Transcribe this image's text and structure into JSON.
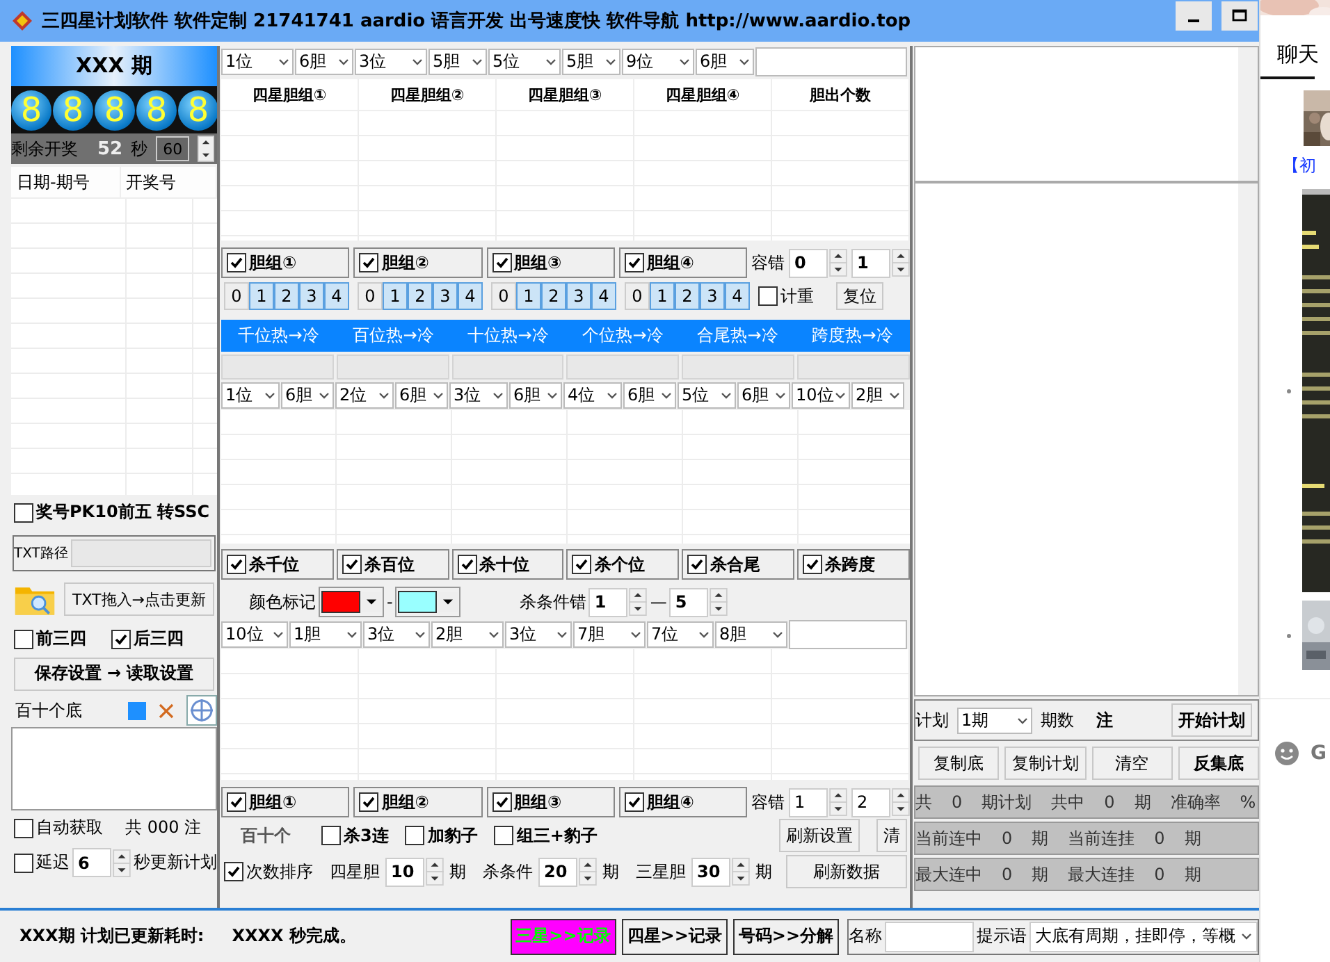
{
  "title": "三四星计划软件  软件定制 21741741 aardio 语言开发 出号速度快 软件导航 http://www.aardio.top",
  "left": {
    "period": "XXX 期",
    "balls": [
      "8",
      "8",
      "8",
      "8",
      "8"
    ],
    "countdown": {
      "label": "剩余开奖",
      "seconds": "52",
      "unit": "秒",
      "interval": "60"
    },
    "history_columns": [
      "日期-期号",
      "开奖号"
    ],
    "pk10": {
      "label": "奖号PK10前五  转SSC",
      "checked": false
    },
    "txt_path": {
      "label": "TXT路径"
    },
    "import_button": "TXT拖入→点击更新",
    "modes": [
      {
        "label": "前三四",
        "checked": false
      },
      {
        "label": "后三四",
        "checked": true
      }
    ],
    "settings_button": "保存设置 → 读取设置",
    "base": {
      "label": "百十个底"
    },
    "auto": {
      "label": "自动获取",
      "checked": false,
      "count": "共 000 注"
    },
    "delay": {
      "label": "延迟",
      "checked": false,
      "seconds": "6",
      "suffix": "秒更新计划"
    }
  },
  "middle": {
    "top_selects": [
      {
        "position": "1位",
        "count": "6胆"
      },
      {
        "position": "3位",
        "count": "5胆"
      },
      {
        "position": "5位",
        "count": "5胆"
      },
      {
        "position": "9位",
        "count": "6胆"
      }
    ],
    "table_columns": [
      "四星胆组①",
      "四星胆组②",
      "四星胆组③",
      "四星胆组④",
      "胆出个数"
    ],
    "groups": [
      {
        "label": "胆组①",
        "checked": true,
        "digits": [
          {
            "digit": "0",
            "selected": false
          },
          {
            "digit": "1",
            "selected": true
          },
          {
            "digit": "2",
            "selected": true
          },
          {
            "digit": "3",
            "selected": true
          },
          {
            "digit": "4",
            "selected": true
          }
        ]
      },
      {
        "label": "胆组②",
        "checked": true,
        "digits": [
          {
            "digit": "0",
            "selected": false
          },
          {
            "digit": "1",
            "selected": true
          },
          {
            "digit": "2",
            "selected": true
          },
          {
            "digit": "3",
            "selected": true
          },
          {
            "digit": "4",
            "selected": true
          }
        ]
      },
      {
        "label": "胆组③",
        "checked": true,
        "digits": [
          {
            "digit": "0",
            "selected": false
          },
          {
            "digit": "1",
            "selected": true
          },
          {
            "digit": "2",
            "selected": true
          },
          {
            "digit": "3",
            "selected": true
          },
          {
            "digit": "4",
            "selected": true
          }
        ]
      },
      {
        "label": "胆组④",
        "checked": true,
        "digits": [
          {
            "digit": "0",
            "selected": false
          },
          {
            "digit": "1",
            "selected": true
          },
          {
            "digit": "2",
            "selected": true
          },
          {
            "digit": "3",
            "selected": true
          },
          {
            "digit": "4",
            "selected": true
          }
        ]
      }
    ],
    "tolerance": {
      "label": "容错",
      "from": "0",
      "to": "1"
    },
    "weight": {
      "label": "计重",
      "checked": false
    },
    "reset_button": "复位",
    "heat_headers": [
      "千位热→冷",
      "百位热→冷",
      "十位热→冷",
      "个位热→冷",
      "合尾热→冷",
      "跨度热→冷"
    ],
    "heat_selects": [
      {
        "position": "1位",
        "count": "6胆"
      },
      {
        "position": "2位",
        "count": "6胆"
      },
      {
        "position": "3位",
        "count": "6胆"
      },
      {
        "position": "4位",
        "count": "6胆"
      },
      {
        "position": "5位",
        "count": "6胆"
      },
      {
        "position": "10位",
        "count": "2胆"
      }
    ],
    "kill_options": [
      {
        "label": "杀千位",
        "checked": true
      },
      {
        "label": "杀百位",
        "checked": true
      },
      {
        "label": "杀十位",
        "checked": true
      },
      {
        "label": "杀个位",
        "checked": true
      },
      {
        "label": "杀合尾",
        "checked": true
      },
      {
        "label": "杀跨度",
        "checked": true
      }
    ],
    "color_mark": {
      "label": "颜色标记",
      "separator": "-",
      "swatches": [
        {
          "color": "#ff0000"
        },
        {
          "color": "#99ffff"
        }
      ]
    },
    "kill_error": {
      "label": "杀条件错",
      "from": "1",
      "separator": "—",
      "to": "5"
    },
    "kill_selects": [
      {
        "position": "10位",
        "count": "1胆"
      },
      {
        "position": "3位",
        "count": "2胆"
      },
      {
        "position": "3位",
        "count": "7胆"
      },
      {
        "position": "7位",
        "count": "8胆"
      }
    ],
    "bottom_groups": [
      {
        "label": "胆组①",
        "checked": true
      },
      {
        "label": "胆组②",
        "checked": true
      },
      {
        "label": "胆组③",
        "checked": true
      },
      {
        "label": "胆组④",
        "checked": true
      }
    ],
    "bottom_tolerance": {
      "label": "容错",
      "from": "1",
      "to": "2"
    },
    "positions_label": "百十个",
    "extra_options": [
      {
        "label": "杀3连",
        "checked": false
      },
      {
        "label": "加豹子",
        "checked": false
      },
      {
        "label": "组三+豹子",
        "checked": false
      }
    ],
    "refresh_settings_button": "刷新设置",
    "clear_button": "清",
    "sort": {
      "label": "次数排序",
      "checked": true
    },
    "periods": [
      {
        "label": "四星胆",
        "value": "10",
        "unit": "期"
      },
      {
        "label": "杀条件",
        "value": "20",
        "unit": "期"
      },
      {
        "label": "三星胆",
        "value": "30",
        "unit": "期"
      }
    ],
    "refresh_data_button": "刷新数据"
  },
  "right": {
    "plan": {
      "label": "计划",
      "value": "1期",
      "periods_label": "期数",
      "bets_label": "注",
      "start_button": "开始计划"
    },
    "actions": [
      "复制底",
      "复制计划",
      "清空",
      "反集底"
    ],
    "stats": [
      [
        "共",
        "0",
        "期计划",
        "共中",
        "0",
        "期",
        "准确率",
        "%"
      ],
      [
        "当前连中",
        "0",
        "期",
        "当前连挂",
        "0",
        "期"
      ],
      [
        "最大连中",
        "0",
        "期",
        "最大连挂",
        "0",
        "期"
      ]
    ]
  },
  "status": {
    "message": "XXX期 计划已更新耗时:",
    "time": "XXXX 秒完成。",
    "record_tabs": [
      {
        "label": "三星>>记录",
        "selected": true
      },
      {
        "label": "四星>>记录",
        "selected": false
      },
      {
        "label": "号码>>分解",
        "selected": false
      }
    ],
    "name_label": "名称",
    "hint_label": "提示语",
    "hint": "大底有周期，挂即停，等概"
  },
  "overlay": {
    "tab": "聊天",
    "link": "【初",
    "letter": "G"
  }
}
